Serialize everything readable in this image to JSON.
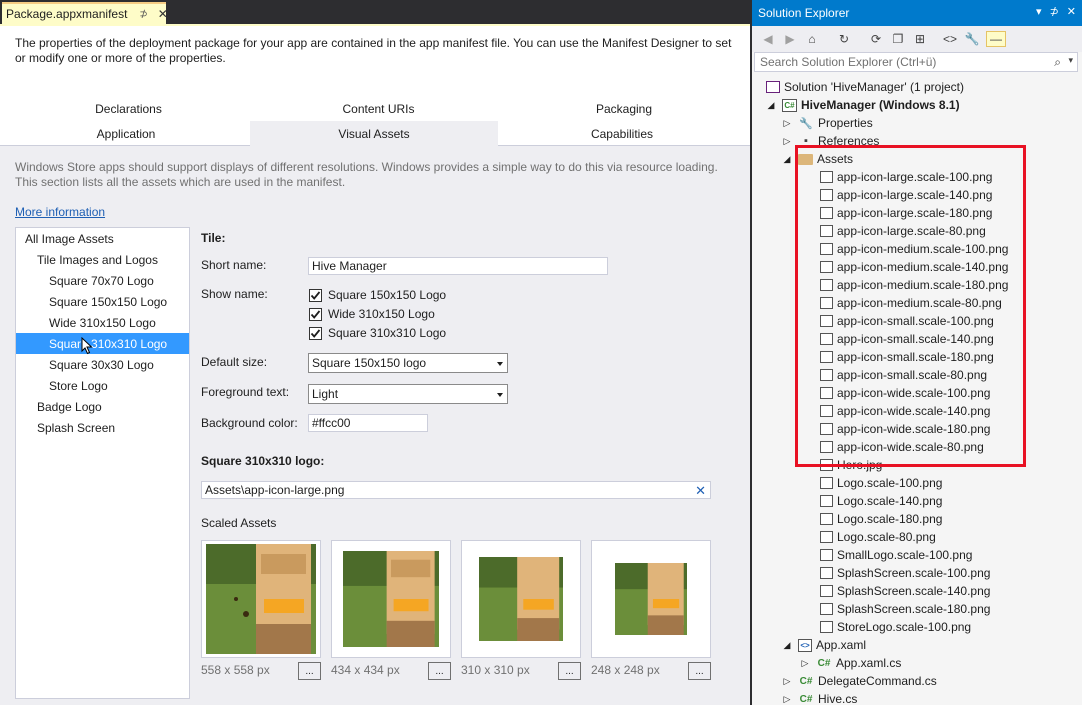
{
  "document": {
    "tab_title": "Package.appxmanifest",
    "pin_glyph": "⊅",
    "close_glyph": "✕",
    "description": "The properties of the deployment package for your app are contained in the app manifest file. You can use the Manifest Designer to set or modify one or more of the properties.",
    "tabs": {
      "declarations": "Declarations",
      "content_uris": "Content URIs",
      "packaging": "Packaging",
      "application": "Application",
      "visual_assets": "Visual Assets",
      "capabilities": "Capabilities"
    },
    "section_description": "Windows Store apps should support displays of different resolutions. Windows provides a simple way to do this via resource loading. This section lists all the assets which are used in the manifest.",
    "more_information": "More information",
    "asset_list": [
      "All Image Assets",
      "Tile Images and Logos",
      "Square 70x70 Logo",
      "Square 150x150 Logo",
      "Wide 310x150 Logo",
      "Square 310x310 Logo",
      "Square 30x30 Logo",
      "Store Logo",
      "Badge Logo",
      "Splash Screen"
    ],
    "tile": {
      "heading": "Tile:",
      "short_name_label": "Short name:",
      "short_name_value": "Hive Manager",
      "show_name_label": "Show name:",
      "show_name_options": [
        "Square 150x150 Logo",
        "Wide 310x150 Logo",
        "Square 310x310 Logo"
      ],
      "default_size_label": "Default size:",
      "default_size_value": "Square 150x150 logo",
      "foreground_label": "Foreground text:",
      "foreground_value": "Light",
      "background_label": "Background color:",
      "background_value": "#ffcc00"
    },
    "logo_section": {
      "title": "Square 310x310 logo:",
      "path": "Assets\\app-icon-large.png",
      "clear_glyph": "✕",
      "scaled_assets_label": "Scaled Assets",
      "browse_label": "...",
      "thumbnails": [
        "558 x 558 px",
        "434 x 434 px",
        "310 x 310 px",
        "248 x 248 px"
      ]
    }
  },
  "solution_explorer": {
    "title": "Solution Explorer",
    "title_buttons": [
      "▾",
      "⊅",
      "✕"
    ],
    "search_placeholder": "Search Solution Explorer (Ctrl+ü)",
    "search_icon": "⌕",
    "search_dropdown": "▾",
    "toolbar_glyphs": [
      "◀",
      "▶",
      "⌂",
      "↻",
      "⟳",
      "❐",
      "⊞",
      "<>",
      "🔧",
      "—"
    ],
    "tree": {
      "solution": "Solution 'HiveManager' (1 project)",
      "project": "HiveManager (Windows 8.1)",
      "properties": "Properties",
      "references": "References",
      "assets_folder": "Assets",
      "assets": [
        "app-icon-large.scale-100.png",
        "app-icon-large.scale-140.png",
        "app-icon-large.scale-180.png",
        "app-icon-large.scale-80.png",
        "app-icon-medium.scale-100.png",
        "app-icon-medium.scale-140.png",
        "app-icon-medium.scale-180.png",
        "app-icon-medium.scale-80.png",
        "app-icon-small.scale-100.png",
        "app-icon-small.scale-140.png",
        "app-icon-small.scale-180.png",
        "app-icon-small.scale-80.png",
        "app-icon-wide.scale-100.png",
        "app-icon-wide.scale-140.png",
        "app-icon-wide.scale-180.png",
        "app-icon-wide.scale-80.png",
        "Hero.jpg",
        "Logo.scale-100.png",
        "Logo.scale-140.png",
        "Logo.scale-180.png",
        "Logo.scale-80.png",
        "SmallLogo.scale-100.png",
        "SplashScreen.scale-100.png",
        "SplashScreen.scale-140.png",
        "SplashScreen.scale-180.png",
        "StoreLogo.scale-100.png"
      ],
      "app_xaml": "App.xaml",
      "app_xaml_cs": "App.xaml.cs",
      "delegate_command": "DelegateCommand.cs",
      "hive": "Hive.cs",
      "cs_glyph": "C#",
      "proj_glyph": "C#",
      "xaml_glyph": "<>"
    }
  },
  "colors": {
    "accent": "#007acc",
    "selection": "#3399ff",
    "highlight_box": "#e81123",
    "tab_active": "#fefcc8"
  }
}
